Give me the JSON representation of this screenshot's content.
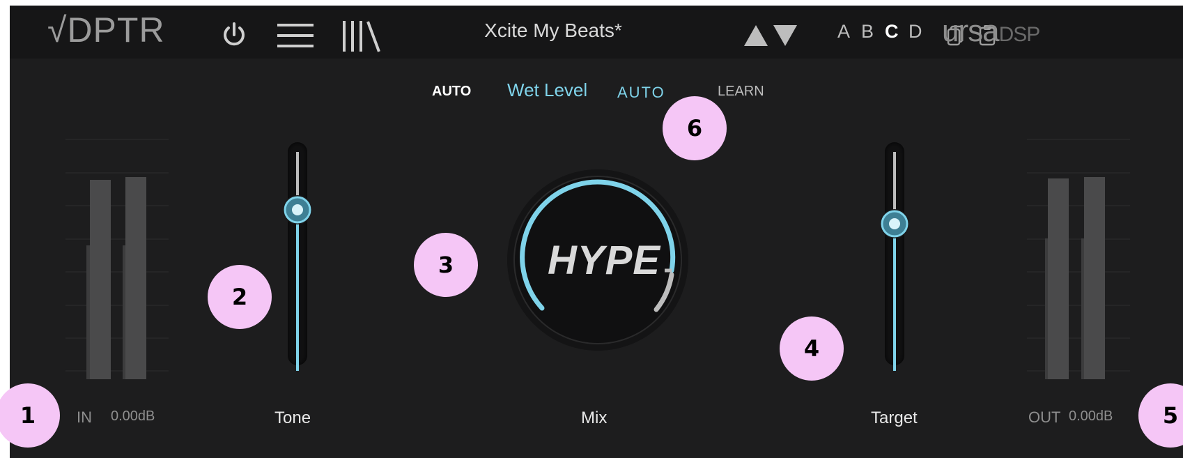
{
  "brand": {
    "logo": "√DPTR",
    "vendor": "ursa",
    "vendor_suffix": "DSP"
  },
  "toolbar": {
    "preset_name": "Xcite My Beats*",
    "ab_slots": [
      "A",
      "B",
      "C",
      "D"
    ],
    "active_slot": "C"
  },
  "automation": {
    "auto_left": "AUTO",
    "param_name": "Wet Level",
    "auto_right": "AUTO",
    "learn": "LEARN"
  },
  "knob": {
    "logo_text": "HYPE",
    "label": "Mix"
  },
  "sliders": {
    "tone": {
      "label": "Tone",
      "level": 0.69
    },
    "target": {
      "label": "Target",
      "level": 0.63
    }
  },
  "meters": {
    "input": {
      "label": "IN",
      "value": "0.00dB"
    },
    "output": {
      "label": "OUT",
      "value": "0.00dB"
    }
  },
  "callouts": [
    "1",
    "2",
    "3",
    "4",
    "5",
    "6"
  ],
  "colors": {
    "accent": "#7fd3ea",
    "badge": "#f5c6f6",
    "background": "#1d1d1e"
  }
}
